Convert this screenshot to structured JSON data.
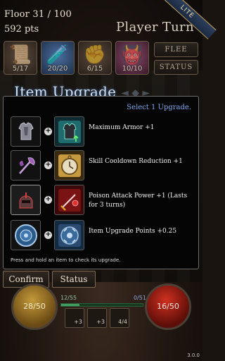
{
  "hud": {
    "floor": "Floor 31 / 100",
    "points": "592 pts",
    "turn": "Player Turn",
    "lite": "LITE",
    "flee_label": "FLEE",
    "status_label": "STATUS",
    "skills": [
      {
        "icon": "scroll-icon",
        "glyph": "📜",
        "count": "5/17"
      },
      {
        "icon": "potion-icon",
        "glyph": "🧪",
        "count": "20/20"
      },
      {
        "icon": "fist-icon",
        "glyph": "✊",
        "count": "6/15"
      },
      {
        "icon": "demon-icon",
        "glyph": "👹",
        "count": "10/10"
      }
    ]
  },
  "upgrade": {
    "title": "Item Upgrade",
    "select_note": "Select 1 Upgrade.",
    "footnote": "Press and hold an item to check its upgrade.",
    "rows": [
      {
        "current_icon": "armor-icon",
        "new_icon": "armor-upgrade-icon",
        "desc": "Maximum Armor +1"
      },
      {
        "current_icon": "axe-icon",
        "new_icon": "pocket-watch-icon",
        "desc": "Skill Cooldown Reduction +1"
      },
      {
        "current_icon": "helmet-icon",
        "new_icon": "poison-dagger-icon",
        "desc": "Poison Attack Power +1 (Lasts for 3 turns)"
      },
      {
        "current_icon": "shield-icon",
        "new_icon": "gear-shield-icon",
        "desc": "Item Upgrade Points +0.25"
      }
    ]
  },
  "buttons": {
    "confirm": "Confirm",
    "status": "Status"
  },
  "bottom": {
    "hp": "28/50",
    "mp": "16/50",
    "xp": "12/55",
    "energy": "0/51",
    "xp_fraction": 0.22,
    "quick_slots": [
      "+3",
      "+3",
      "4/4"
    ],
    "version": "3.0.0"
  },
  "colors": {
    "accent_blue": "#7ea8ee",
    "title_blue": "#cfe0f5",
    "hp_gold": "#c49a3a",
    "mp_red": "#d03020"
  }
}
